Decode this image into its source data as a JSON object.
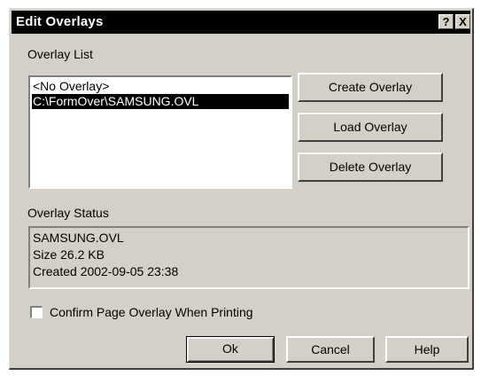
{
  "dialog": {
    "title": "Edit Overlays",
    "help_button": "?",
    "close_button": "X"
  },
  "overlay_list": {
    "label": "Overlay List",
    "items": [
      "<No Overlay>",
      "C:\\FormOver\\SAMSUNG.OVL"
    ],
    "selected_index": 1
  },
  "buttons": {
    "create": "Create Overlay",
    "load": "Load Overlay",
    "delete": "Delete Overlay",
    "ok": "Ok",
    "cancel": "Cancel",
    "help": "Help"
  },
  "overlay_status": {
    "label": "Overlay Status",
    "lines": [
      "SAMSUNG.OVL",
      "Size 26.2 KB",
      "Created 2002-09-05 23:38"
    ]
  },
  "confirm_checkbox": {
    "label": "Confirm Page Overlay When Printing",
    "checked": false
  }
}
